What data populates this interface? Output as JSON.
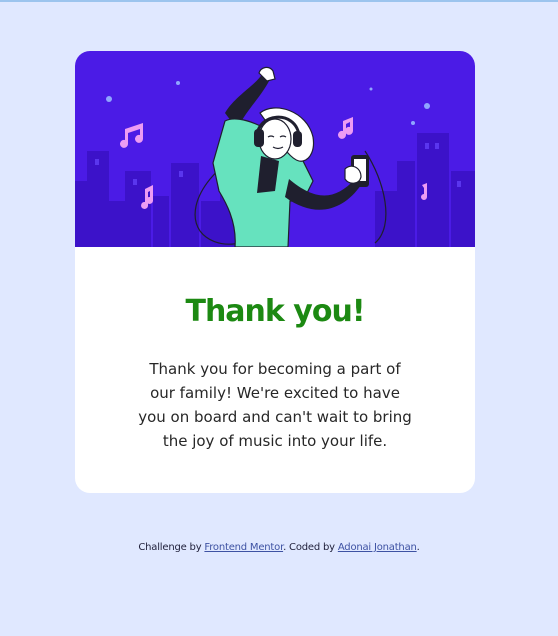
{
  "card": {
    "title": "Thank you!",
    "message": "Thank you for becoming a part of our family! We're excited to have you on board and can't wait to bring the joy of music into your life."
  },
  "attribution": {
    "prefix": "Challenge by",
    "link1": "Frontend Mentor",
    "middle": ". Coded by",
    "link2": "Adonai Jonathan",
    "suffix": "."
  },
  "colors": {
    "page_background": "#e0e8ff",
    "hero_background": "#4b1be6",
    "title_green": "#1c8912",
    "link_blue": "#3e52a3"
  },
  "icons": [
    "music-note-icon",
    "headphones-icon",
    "phone-icon"
  ]
}
